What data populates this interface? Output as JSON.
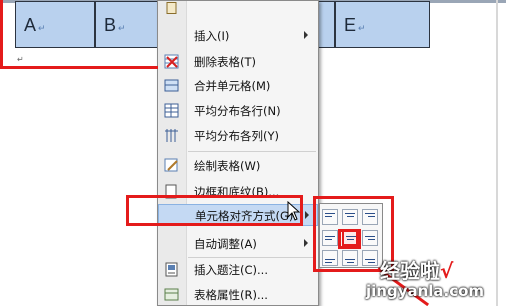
{
  "table": {
    "cells": [
      {
        "text": "A",
        "mark": "↵"
      },
      {
        "text": "B",
        "mark": "↵"
      },
      {
        "text": "E",
        "mark": "↵"
      }
    ]
  },
  "paragraph_mark": "↵",
  "menu": {
    "items": [
      {
        "label": "插入(I)",
        "icon": "insert-icon",
        "submenu": true
      },
      {
        "label": "删除表格(T)",
        "icon": "delete-table-icon"
      },
      {
        "label": "合并单元格(M)",
        "icon": "merge-cells-icon"
      },
      {
        "label": "平均分布各行(N)",
        "icon": "distribute-rows-icon"
      },
      {
        "label": "平均分布各列(Y)",
        "icon": "distribute-columns-icon"
      },
      {
        "label": "绘制表格(W)",
        "icon": "draw-table-icon"
      },
      {
        "label": "边框和底纹(B)...",
        "icon": "borders-shading-icon"
      },
      {
        "label": "单元格对齐方式(G)",
        "icon": "",
        "submenu": true,
        "highlighted": true
      },
      {
        "label": "自动调整(A)",
        "icon": "",
        "submenu": true
      },
      {
        "label": "插入题注(C)...",
        "icon": "insert-caption-icon"
      },
      {
        "label": "表格属性(R)...",
        "icon": "table-properties-icon"
      }
    ]
  },
  "alignment_submenu": {
    "options": [
      "top-left",
      "top-center",
      "top-right",
      "middle-left",
      "middle-center",
      "middle-right",
      "bottom-left",
      "bottom-center",
      "bottom-right"
    ],
    "selected": "middle-center"
  },
  "watermark": {
    "text": "经验啦",
    "check": "√",
    "url": "jingyanla.com"
  },
  "colors": {
    "cell_fill": "#b9d1ee",
    "highlight": "#c4d9f3",
    "red_annotation": "#e41b1b"
  }
}
